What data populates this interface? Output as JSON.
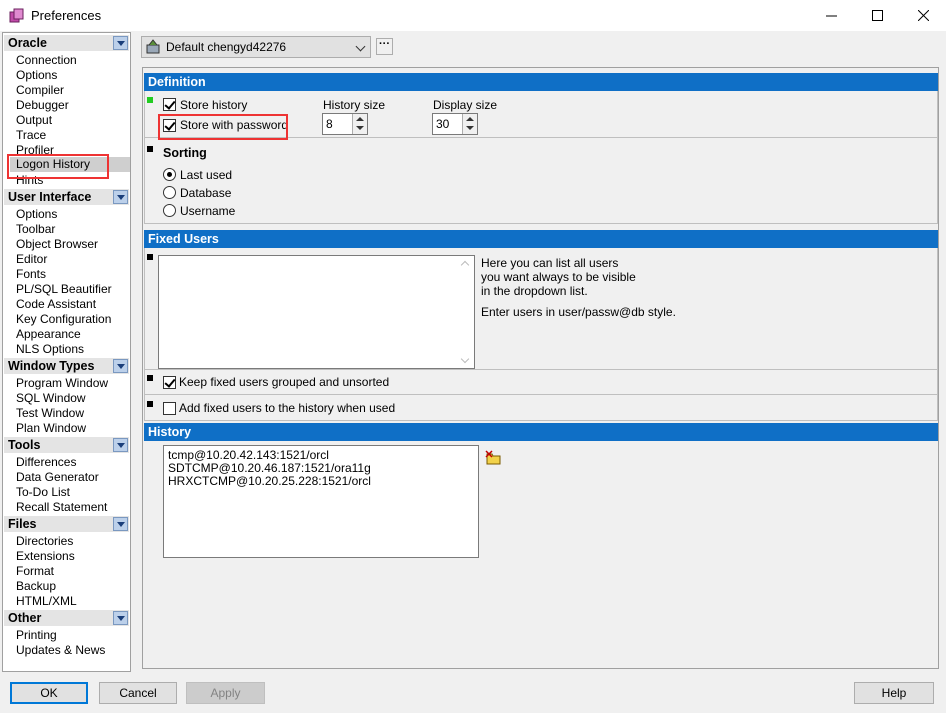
{
  "window": {
    "title": "Preferences"
  },
  "nav": {
    "sections": [
      {
        "title": "Oracle",
        "items": [
          "Connection",
          "Options",
          "Compiler",
          "Debugger",
          "Output",
          "Trace",
          "Profiler",
          "Logon History",
          "Hints"
        ],
        "selected": 7
      },
      {
        "title": "User Interface",
        "items": [
          "Options",
          "Toolbar",
          "Object Browser",
          "Editor",
          "Fonts",
          "PL/SQL Beautifier",
          "Code Assistant",
          "Key Configuration",
          "Appearance",
          "NLS Options"
        ]
      },
      {
        "title": "Window Types",
        "items": [
          "Program Window",
          "SQL Window",
          "Test Window",
          "Plan Window"
        ]
      },
      {
        "title": "Tools",
        "items": [
          "Differences",
          "Data Generator",
          "To-Do List",
          "Recall Statement"
        ]
      },
      {
        "title": "Files",
        "items": [
          "Directories",
          "Extensions",
          "Format",
          "Backup",
          "HTML/XML"
        ]
      },
      {
        "title": "Other",
        "items": [
          "Printing",
          "Updates & News"
        ]
      }
    ]
  },
  "profile": {
    "selected": "Default chengyd42276",
    "more_label": "···"
  },
  "definition": {
    "header": "Definition",
    "store_history": {
      "label": "Store history",
      "checked": true
    },
    "store_password": {
      "label": "Store with password",
      "checked": true
    },
    "history_size": {
      "label": "History size",
      "value": "8"
    },
    "display_size": {
      "label": "Display size",
      "value": "30"
    }
  },
  "sorting": {
    "title": "Sorting",
    "options": [
      "Last used",
      "Database",
      "Username"
    ],
    "selected": "Last used"
  },
  "fixed_users": {
    "header": "Fixed Users",
    "help_lines": [
      "Here you can list all users",
      "you want always to be visible",
      "in the dropdown list."
    ],
    "help_note": "Enter users in user/passw@db style.",
    "keep_grouped": {
      "label": "Keep fixed users grouped and unsorted",
      "checked": true
    },
    "add_to_history": {
      "label": "Add fixed users to the history when used",
      "checked": false
    }
  },
  "history": {
    "header": "History",
    "entries": [
      "tcmp@10.20.42.143:1521/orcl",
      "SDTCMP@10.20.46.187:1521/ora11g",
      "HRXCTCMP@10.20.25.228:1521/orcl"
    ]
  },
  "footer": {
    "ok": "OK",
    "cancel": "Cancel",
    "apply": "Apply",
    "help": "Help"
  }
}
